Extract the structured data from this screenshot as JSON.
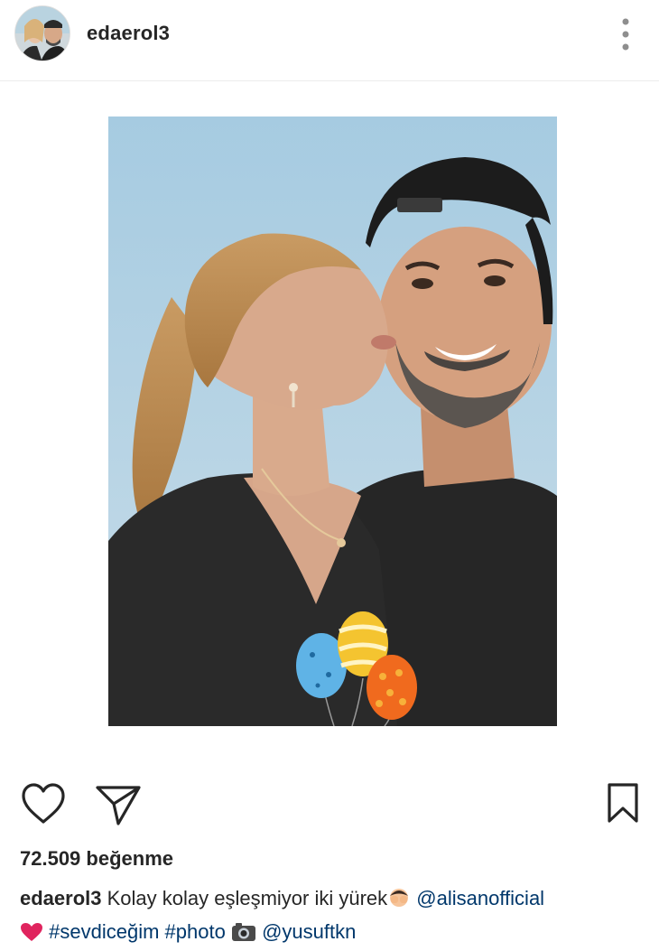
{
  "header": {
    "username": "edaerol3",
    "more_icon": "more-vertical-icon"
  },
  "post": {
    "photo": {
      "balloon_colors": [
        "#5fb3e6",
        "#f4c430",
        "#f06a1e"
      ],
      "sky_color": "#a9cde2"
    }
  },
  "actions": {
    "like_icon": "heart-outline-icon",
    "share_icon": "send-paper-plane-icon",
    "save_icon": "bookmark-outline-icon"
  },
  "likes": {
    "text": "72.509 beğenme"
  },
  "caption": {
    "username": "edaerol3",
    "text": " Kolay kolay eşleşmiyor iki yürek",
    "emoji_1": "face-with-hands-over-eyes-icon",
    "mention_1": "@alisanofficial",
    "heart_emoji": "red-heart-icon",
    "hashtag_1": "#sevdiceğim",
    "hashtag_2": "#photo",
    "camera_emoji": "camera-icon",
    "mention_2": "@yusuftkn"
  }
}
